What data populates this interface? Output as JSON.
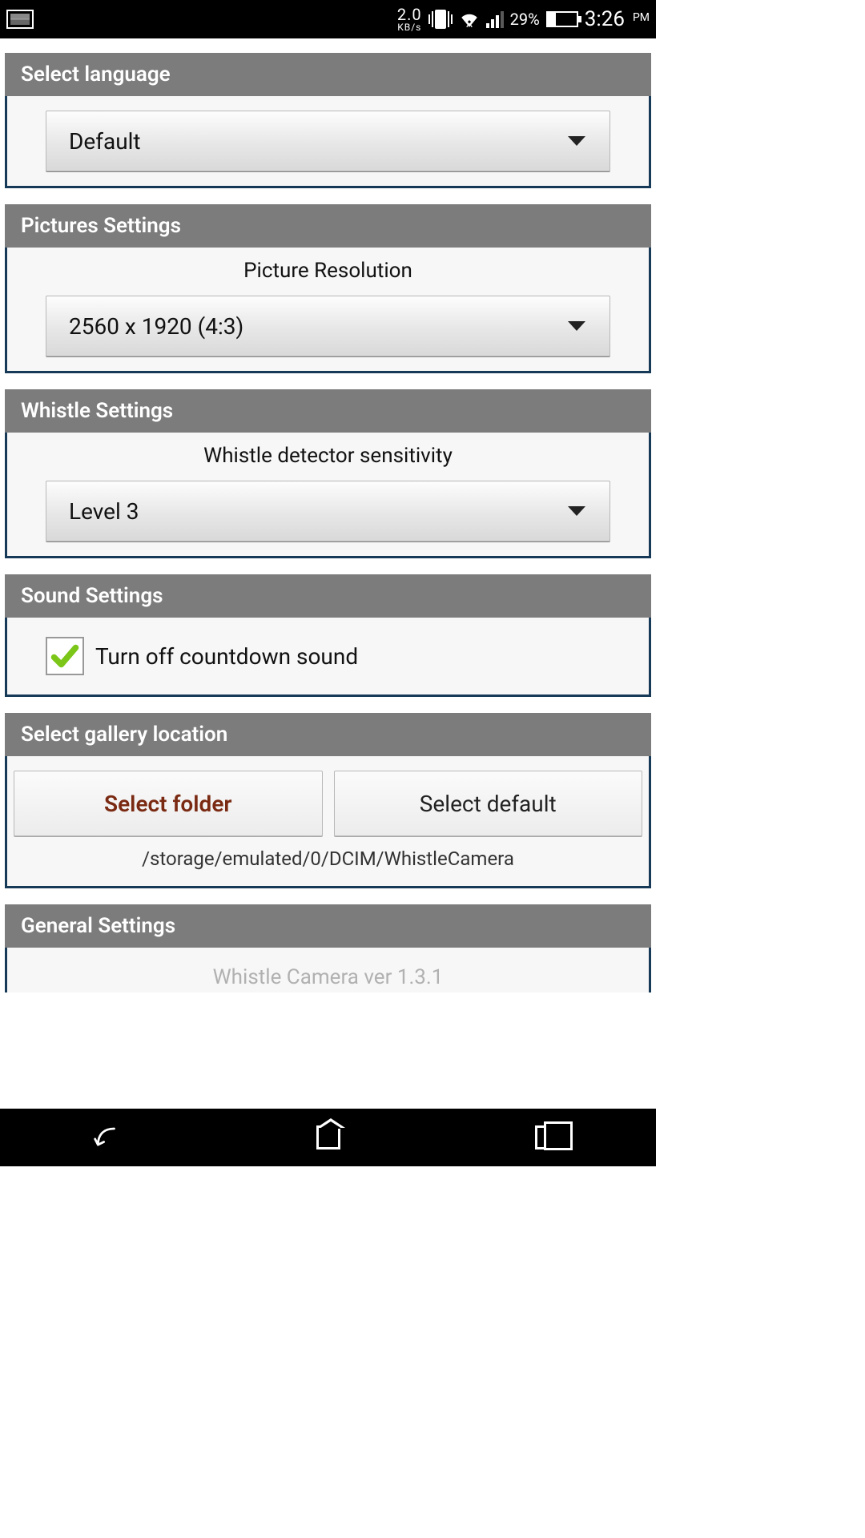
{
  "status": {
    "kb_rate": "2.0",
    "kb_unit": "KB/s",
    "battery_pct": "29%",
    "time": "3:26",
    "ampm": "PM"
  },
  "sections": {
    "language": {
      "title": "Select language",
      "value": "Default"
    },
    "pictures": {
      "title": "Pictures Settings",
      "label": "Picture Resolution",
      "value": "2560 x 1920 (4:3)"
    },
    "whistle": {
      "title": "Whistle Settings",
      "label": "Whistle detector sensitivity",
      "value": "Level 3"
    },
    "sound": {
      "title": "Sound Settings",
      "checkbox_label": "Turn off countdown sound",
      "checked": true
    },
    "gallery": {
      "title": "Select gallery location",
      "select_folder": "Select folder",
      "select_default": "Select default",
      "path": "/storage/emulated/0/DCIM/WhistleCamera"
    },
    "general": {
      "title": "General Settings",
      "version": "Whistle Camera ver 1.3.1"
    }
  }
}
